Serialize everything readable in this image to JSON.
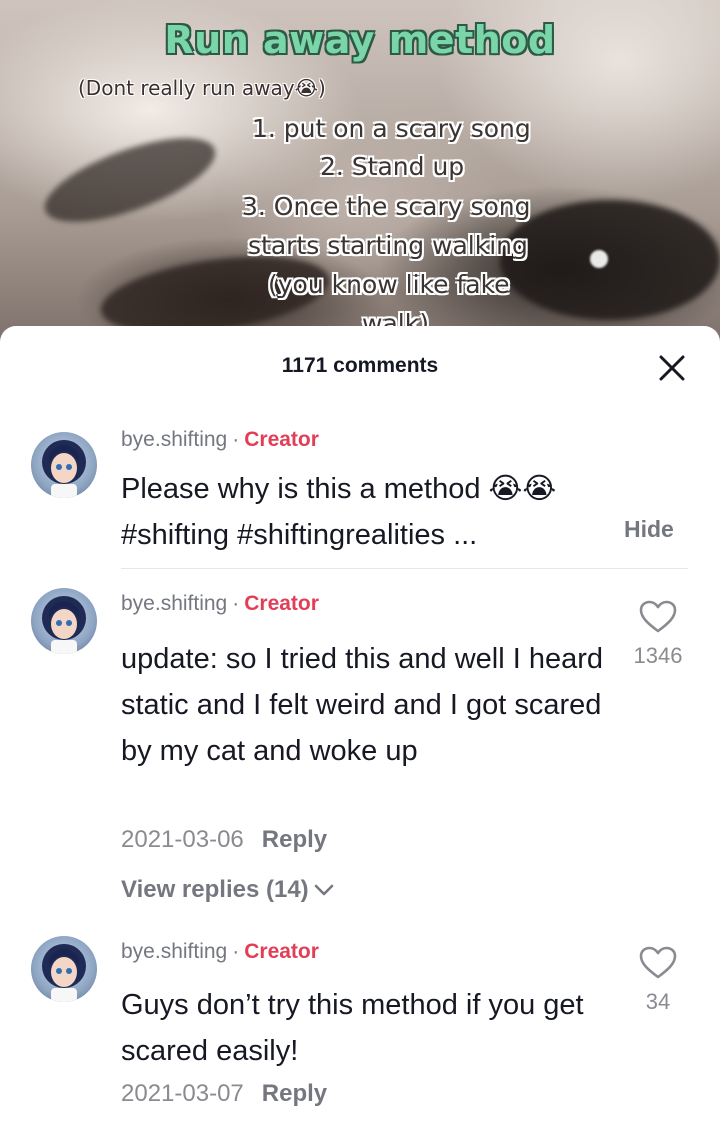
{
  "video": {
    "title": "Run away method",
    "subtitle": "(Dont really run away😭)",
    "lines": [
      "1. put on a scary song",
      "2. Stand up",
      "3. Once the scary song",
      "starts starting walking",
      "(you know like fake",
      "walk)"
    ]
  },
  "comments_header": {
    "count_label": "1171 comments",
    "close_icon": "close-icon"
  },
  "comments": [
    {
      "username": "bye.shifting",
      "badge": "Creator",
      "text": "Please why is this a method 😭😭 #shifting #shiftingrealities ...",
      "action": "Hide"
    },
    {
      "username": "bye.shifting",
      "badge": "Creator",
      "text": "update: so I tried this and well I heard static and I felt weird and I got scared by my cat and woke up",
      "date": "2021-03-06",
      "reply_label": "Reply",
      "likes": "1346",
      "view_replies": "View replies (14)"
    },
    {
      "username": "bye.shifting",
      "badge": "Creator",
      "text": "Guys don’t try this method if you get scared easily!",
      "date": "2021-03-07",
      "reply_label": "Reply",
      "likes": "34"
    }
  ],
  "colors": {
    "accent": "#e23e57",
    "title_green": "#7ad6a8",
    "text_primary": "#161823",
    "text_secondary": "#757780"
  }
}
